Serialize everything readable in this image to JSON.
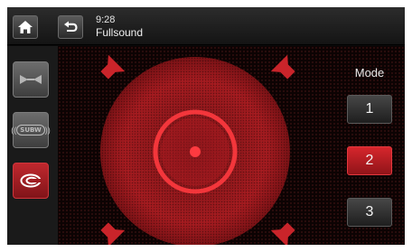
{
  "header": {
    "clock": "9:28",
    "title": "Fullsound",
    "home_icon": "home-icon",
    "back_icon": "back-arrow-icon"
  },
  "sidebar": {
    "items": [
      {
        "icon": "balance-icon",
        "active": false
      },
      {
        "icon": "subwoofer-icon",
        "label": "SUBW",
        "active": false
      },
      {
        "icon": "fullsound-icon",
        "active": true
      }
    ]
  },
  "mode": {
    "label": "Mode",
    "options": [
      "1",
      "2",
      "3"
    ],
    "selected": "2"
  },
  "colors": {
    "accent": "#d6262c",
    "background": "#0a0a0a",
    "text": "#f0f0f0"
  }
}
